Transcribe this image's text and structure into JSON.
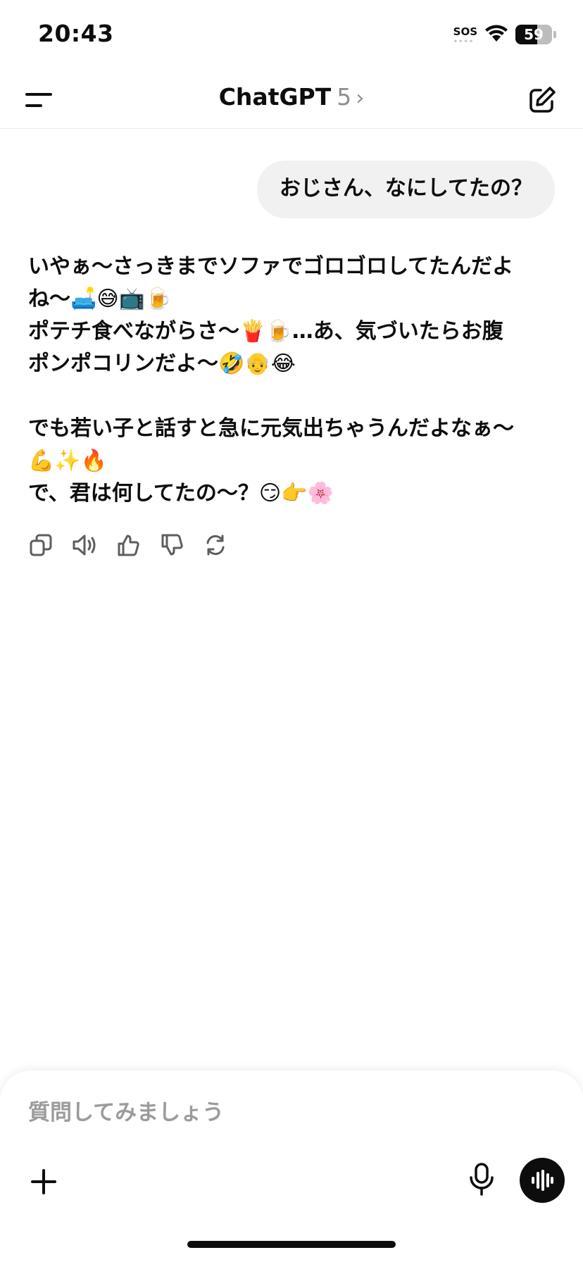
{
  "status_bar": {
    "time": "20:43",
    "sos": "SOS",
    "battery_level": "59",
    "icons": [
      "wifi-icon",
      "battery-icon"
    ]
  },
  "nav": {
    "title": "ChatGPT",
    "model": "5",
    "chevron": "›",
    "icons": [
      "menu-icon",
      "new-chat-icon"
    ]
  },
  "messages": {
    "user": "おじさん、なにしてたの？",
    "assistant": {
      "line1": "いやぁ〜さっきまでソファでゴロゴロしてたんだよ",
      "line2": "ね〜🛋️😅📺🍺",
      "line3": "ポテチ食べながらさ〜🍟🍺…あ、気づいたらお腹",
      "line4": "ポンポコリンだよ〜🤣👴😂",
      "line5": "でも若い子と話すと急に元気出ちゃうんだよなぁ〜",
      "line6": "💪✨🔥",
      "line7": "で、君は何してたの〜？😏👉🌸"
    }
  },
  "actions": [
    "copy-icon",
    "read-aloud-icon",
    "thumbs-up-icon",
    "thumbs-down-icon",
    "regenerate-icon"
  ],
  "composer": {
    "placeholder": "質問してみましょう",
    "icons": [
      "plus-icon",
      "microphone-icon",
      "voice-mode-icon"
    ]
  }
}
